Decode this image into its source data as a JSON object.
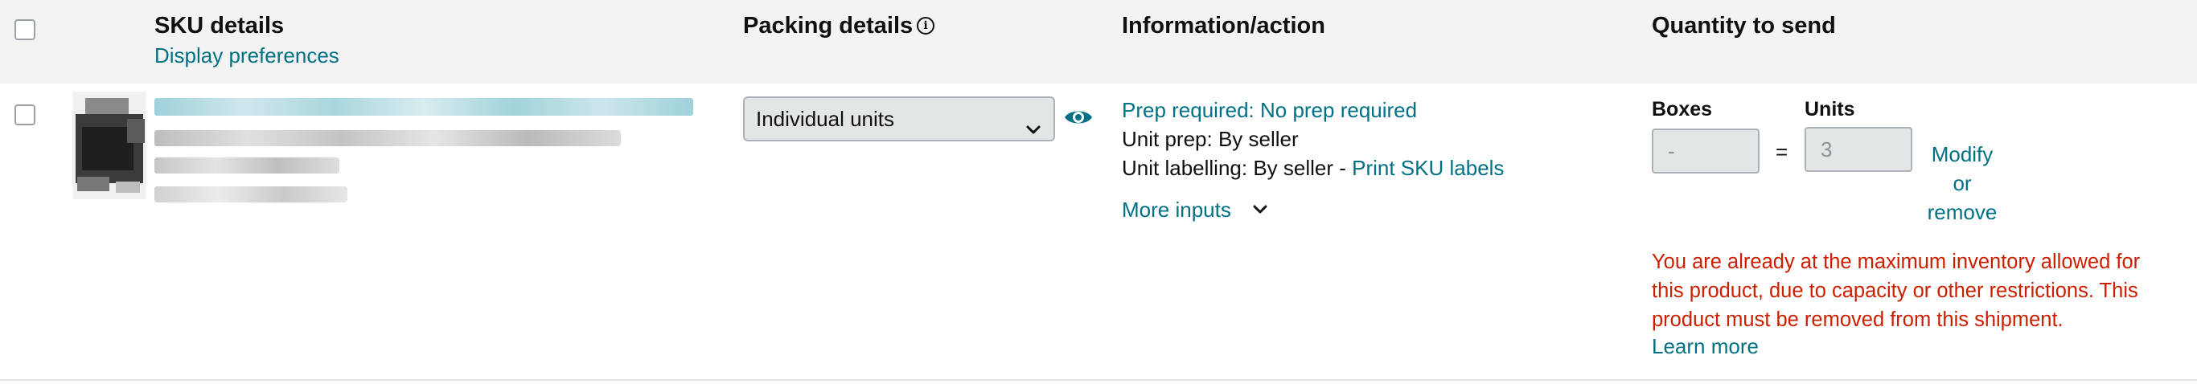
{
  "header": {
    "sku_details": "SKU details",
    "display_preferences": "Display preferences",
    "packing_details": "Packing details",
    "info_symbol": "i",
    "information_action": "Information/action",
    "quantity_to_send": "Quantity to send"
  },
  "row": {
    "packing_select": "Individual units",
    "prep_required": "Prep required: No prep required",
    "unit_prep": "Unit prep: By seller",
    "unit_labelling": "Unit labelling: By seller - ",
    "print_sku_labels": "Print SKU labels",
    "more_inputs": "More inputs",
    "boxes_label": "Boxes",
    "units_label": "Units",
    "boxes_value": "-",
    "units_value": "3",
    "equals": "=",
    "modify": "Modify",
    "or": "or",
    "remove": "remove",
    "error_message": "You are already at the maximum inventory allowed for this product, due to capacity or other restrictions. This product must be removed from this shipment.",
    "learn_more": "Learn more"
  },
  "colors": {
    "link": "#007185",
    "error": "#cc1f00",
    "header_bg": "#f3f3f3"
  }
}
